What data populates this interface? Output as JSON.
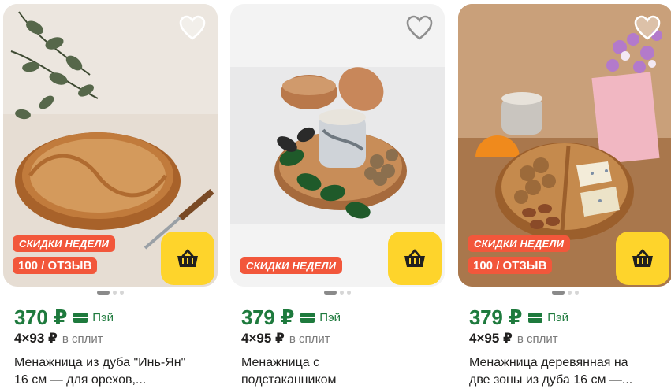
{
  "products": [
    {
      "price": "370 ₽",
      "pay_label": "Пэй",
      "split_amount": "4×93 ₽",
      "split_label": "в сплит",
      "title_line1": "Менажница из дуба \"Инь-Ян\"",
      "title_line2": "16 см — для орехов,...",
      "sale_badge": "СКИДКИ НЕДЕЛИ",
      "points_badge": "100 / ОТЗЫВ",
      "image": "yin-yang-oak-dish-photo"
    },
    {
      "price": "379 ₽",
      "pay_label": "Пэй",
      "split_amount": "4×95 ₽",
      "split_label": "в сплит",
      "title_line1": "Менажница с",
      "title_line2": "подстаканником",
      "sale_badge": "СКИДКИ НЕДЕЛИ",
      "image": "dish-with-cup-holder-photo"
    },
    {
      "price": "379 ₽",
      "pay_label": "Пэй",
      "split_amount": "4×95 ₽",
      "split_label": "в сплит",
      "title_line1": "Менажница деревянная на",
      "title_line2": "две зоны из дуба 16 см —...",
      "sale_badge": "СКИДКИ НЕДЕЛИ",
      "points_badge": "100 / ОТЗЫВ",
      "image": "two-zone-oak-dish-photo"
    }
  ],
  "icons": {
    "favorite": "heart-outline-icon",
    "cart": "basket-icon",
    "pay": "card-icon",
    "points": "points-check-icon"
  },
  "colors": {
    "price_green": "#1e7a3d",
    "badge_red": "#f2573b",
    "cart_yellow": "#fed42b"
  }
}
